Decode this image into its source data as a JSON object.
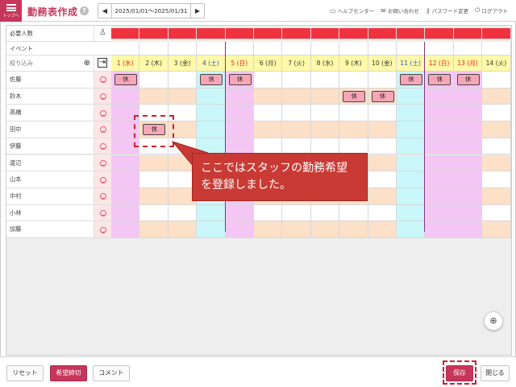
{
  "header": {
    "menu_label": "トップへ",
    "title": "勤務表作成",
    "help": "?",
    "date_range": "2025/01/01～2025/01/31",
    "prev": "◀",
    "next": "▶",
    "links": [
      {
        "label": "ヘルプセンター",
        "icon": "book-icon"
      },
      {
        "label": "お問い合わせ",
        "icon": "mail-icon"
      },
      {
        "label": "パスワード変更",
        "icon": "key-icon"
      },
      {
        "label": "ログアウト",
        "icon": "logout-icon"
      }
    ]
  },
  "grid": {
    "required_label": "必要人数",
    "event_label": "イベント",
    "filter_placeholder": "絞り込み",
    "days": [
      {
        "label": "1 (水)",
        "type": "holiday"
      },
      {
        "label": "2 (木)",
        "type": "weekday"
      },
      {
        "label": "3 (金)",
        "type": "weekday"
      },
      {
        "label": "4 (土)",
        "type": "sat"
      },
      {
        "label": "5 (日)",
        "type": "sun"
      },
      {
        "label": "6 (月)",
        "type": "weekday"
      },
      {
        "label": "7 (火)",
        "type": "weekday"
      },
      {
        "label": "8 (水)",
        "type": "weekday"
      },
      {
        "label": "9 (木)",
        "type": "weekday"
      },
      {
        "label": "10 (金)",
        "type": "weekday"
      },
      {
        "label": "11 (土)",
        "type": "sat"
      },
      {
        "label": "12 (日)",
        "type": "sun"
      },
      {
        "label": "13 (月)",
        "type": "holiday"
      },
      {
        "label": "14 (火)",
        "type": "weekday"
      }
    ],
    "staff": [
      {
        "name": "佐藤",
        "off": [
          1,
          4,
          5,
          11,
          12,
          13
        ]
      },
      {
        "name": "鈴木",
        "off": [
          9,
          10
        ]
      },
      {
        "name": "高橋",
        "off": []
      },
      {
        "name": "田中",
        "off": [
          2
        ]
      },
      {
        "name": "伊藤",
        "off": []
      },
      {
        "name": "渡辺",
        "off": []
      },
      {
        "name": "山本",
        "off": []
      },
      {
        "name": "中村",
        "off": []
      },
      {
        "name": "小林",
        "off": []
      },
      {
        "name": "加藤",
        "off": []
      }
    ],
    "off_label": "休"
  },
  "callout": {
    "text_line1": "ここではスタッフの勤務希望",
    "text_line2": "を登録しました。"
  },
  "footer": {
    "reset": "リセット",
    "deadline": "希望締切",
    "comment": "コメント",
    "save": "保存",
    "close": "閉じる"
  },
  "colors": {
    "brand": "#c7365a",
    "required_bar": "#f0323f",
    "header_yellow": "#fff9a8",
    "weekday_row": "#fde0c8",
    "sat_col": "#c9f6f8",
    "sun_col": "#f4c6f4",
    "off_chip": "#f7a6b8",
    "callout": "#c93a35"
  }
}
